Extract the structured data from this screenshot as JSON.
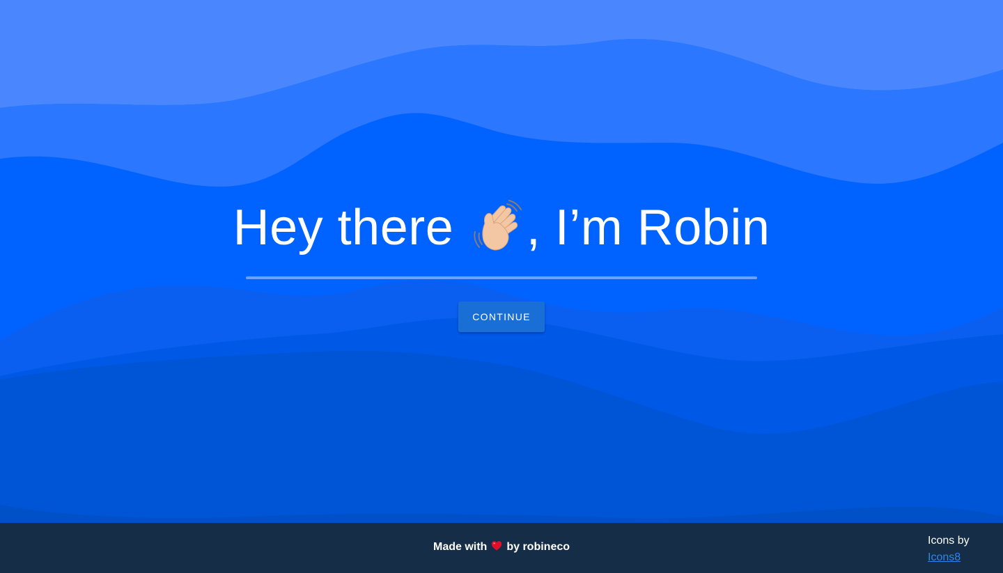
{
  "hero": {
    "headline_prefix": "Hey there ",
    "headline_suffix": ", I’m Robin",
    "emoji": "waving-hand",
    "continue_label": "CONTINUE"
  },
  "footer": {
    "made_with_prefix": "Made with",
    "made_with_suffix": "by robineco",
    "credits_label": "Icons by",
    "credits_link": "Icons8"
  },
  "colors": {
    "background": "#0063ff",
    "wave_light": "#4a87ff",
    "wave_mid": "#2c77ff",
    "wave_dark": "#0059e6",
    "wave_darker": "#0055d6",
    "button": "#1a6fd6",
    "footer": "#152d46",
    "link": "#2f86e9"
  }
}
